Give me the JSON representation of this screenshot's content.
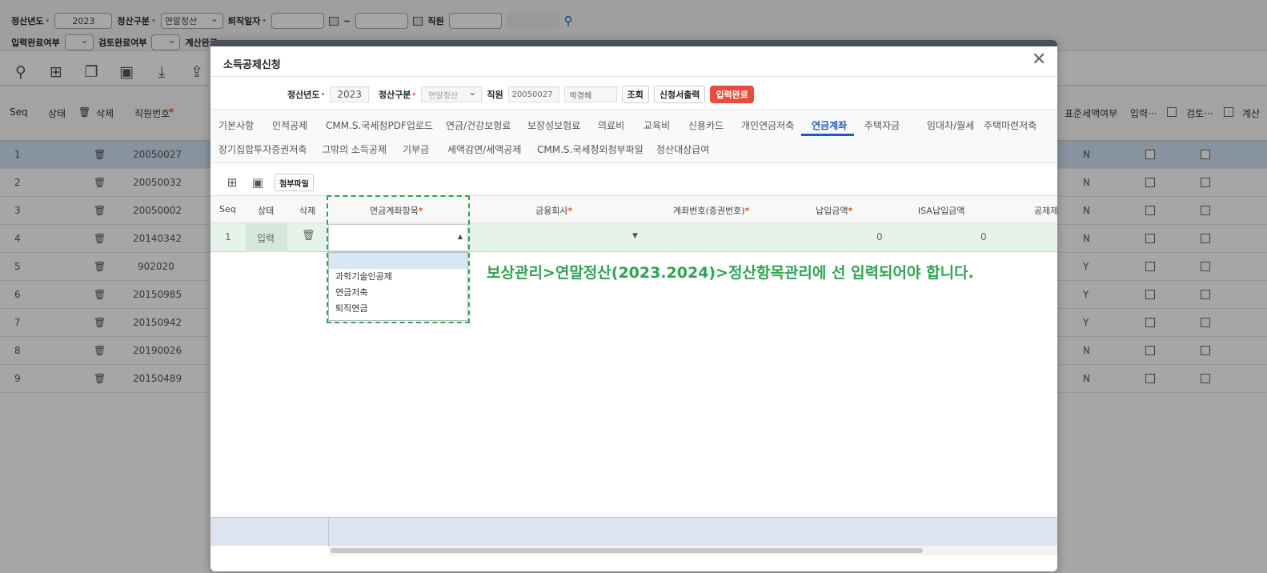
{
  "filter": {
    "row1": {
      "year_label": "정산년도",
      "year_value": "2023",
      "type_label": "정산구분",
      "type_value": "연말정산",
      "retire_label": "퇴직일자",
      "range_sep": "~",
      "emp_label": "직원"
    },
    "row2": {
      "input_done_label": "입력완료여부",
      "review_done_label": "검토완료여부",
      "calc_done_label": "계산완료"
    },
    "required_mark": "•"
  },
  "bg_grid": {
    "headers": {
      "seq": "Seq",
      "status": "상태",
      "delete": "삭제",
      "emp_no": "직원번호",
      "std_deduction": "표준세액여부",
      "input": "입력···",
      "review": "검토···",
      "calc": "계산"
    },
    "required_star": "*",
    "rows": [
      {
        "seq": "1",
        "emp_no": "20050027",
        "std": "N"
      },
      {
        "seq": "2",
        "emp_no": "20050032",
        "std": "N"
      },
      {
        "seq": "3",
        "emp_no": "20050002",
        "std": "N"
      },
      {
        "seq": "4",
        "emp_no": "20140342",
        "std": "N"
      },
      {
        "seq": "5",
        "emp_no": "902020",
        "std": "Y"
      },
      {
        "seq": "6",
        "emp_no": "20150985",
        "std": "Y"
      },
      {
        "seq": "7",
        "emp_no": "20150942",
        "std": "Y"
      },
      {
        "seq": "8",
        "emp_no": "20190026",
        "std": "N"
      },
      {
        "seq": "9",
        "emp_no": "20150489",
        "std": "N"
      }
    ]
  },
  "modal": {
    "title": "소득공제신청",
    "filter": {
      "year_label": "정산년도",
      "year_value": "2023",
      "type_label": "정산구분",
      "type_value": "연말정산",
      "emp_label": "직원",
      "emp_no": "20050027",
      "emp_name": "박경혜",
      "search_button": "조회",
      "print_button": "신청서출력",
      "done_badge": "입력완료"
    },
    "tabs_row1": [
      "기본사항",
      "인적공제",
      "CMM.S.국세청PDF업로드",
      "연금/건강보험료",
      "보장성보험료",
      "의료비",
      "교육비",
      "신용카드",
      "개인연금저축",
      "연금계좌",
      "주택자금",
      "임대차/월세",
      "주택마련저축"
    ],
    "tabs_row2": [
      "장기집합투자증권저축",
      "그밖의 소득공제",
      "기부금",
      "세액감면/세액공제",
      "CMM.S.국세청외첨부파일",
      "정산대상급여"
    ],
    "active_tab": "연금계좌",
    "attach_button": "첨부파일",
    "grid": {
      "headers": {
        "seq": "Seq",
        "status": "상태",
        "delete": "삭제",
        "pension_item": "연금계좌항목",
        "financial_co": "금융회사",
        "account_no": "계좌번호(증권번호)",
        "payment": "납입금액",
        "isa_payment": "ISA납입금액",
        "deduction": "공제제외"
      },
      "required_star": "*",
      "row": {
        "seq": "1",
        "status": "입력",
        "payment": "0",
        "isa_payment": "0"
      },
      "dropdown_options": [
        "",
        "과학기술인공제",
        "연금저축",
        "퇴직연금"
      ]
    },
    "annotation": "보상관리>연말정산(2023.2024)>정산항목관리에 선 입력되어야 합니다."
  }
}
